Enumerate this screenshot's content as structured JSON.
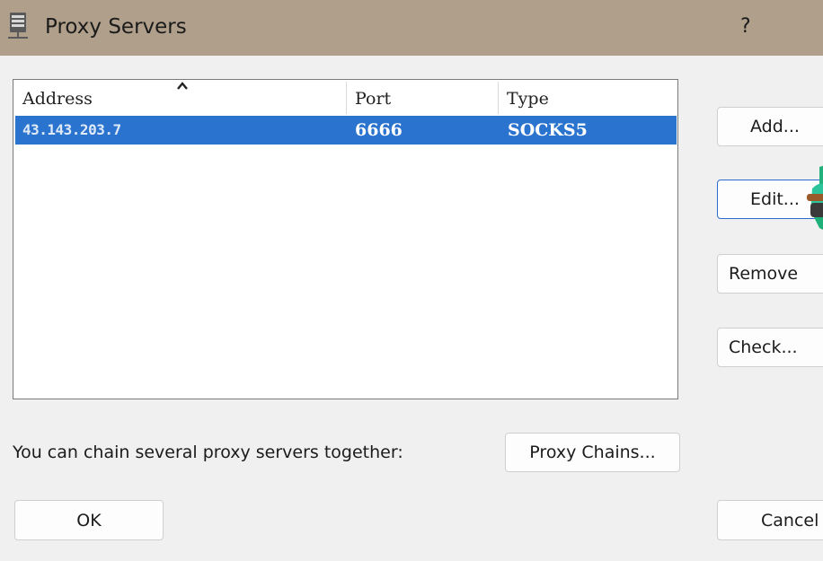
{
  "window": {
    "title": "Proxy Servers",
    "help": "?"
  },
  "table": {
    "columns": [
      "Address",
      "Port",
      "Type"
    ],
    "sort_column": "Address",
    "rows": [
      {
        "address": "43.143.203.7",
        "port": "6666",
        "type": "SOCKS5",
        "selected": true
      }
    ]
  },
  "buttons": {
    "add": "Add...",
    "edit": "Edit...",
    "remove": "Remove",
    "check": "Check...",
    "proxy_chains": "Proxy Chains...",
    "ok": "OK",
    "cancel": "Cancel"
  },
  "hint": "You can chain several proxy servers together:",
  "icons": {
    "title": "server-icon",
    "sort": "sort-ascending-icon",
    "cursor": "cursor-figure-icon"
  },
  "colors": {
    "titlebar": "#b09f8a",
    "selection": "#2a73cf",
    "focus_border": "#2c6ad1"
  }
}
